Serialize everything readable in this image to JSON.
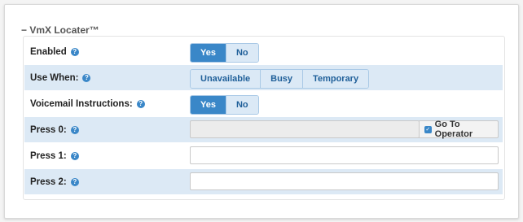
{
  "section": {
    "title": "− VmX Locater™"
  },
  "rows": {
    "enabled": {
      "label": "Enabled",
      "options": [
        "Yes",
        "No"
      ],
      "selected": "Yes"
    },
    "use_when": {
      "label": "Use When:",
      "options": [
        "Unavailable",
        "Busy",
        "Temporary"
      ],
      "selected": ""
    },
    "voicemail": {
      "label": "Voicemail Instructions:",
      "options": [
        "Yes",
        "No"
      ],
      "selected": "Yes"
    },
    "press0": {
      "label": "Press 0:",
      "value": "",
      "operator_label": "Go To Operator",
      "operator_checked": true
    },
    "press1": {
      "label": "Press 1:",
      "value": ""
    },
    "press2": {
      "label": "Press 2:",
      "value": ""
    }
  },
  "colors": {
    "accent": "#3a87c8",
    "row_alt": "#dce9f5"
  },
  "icons": {
    "help": "question-circle-icon",
    "checkbox": "checkmark-icon"
  }
}
